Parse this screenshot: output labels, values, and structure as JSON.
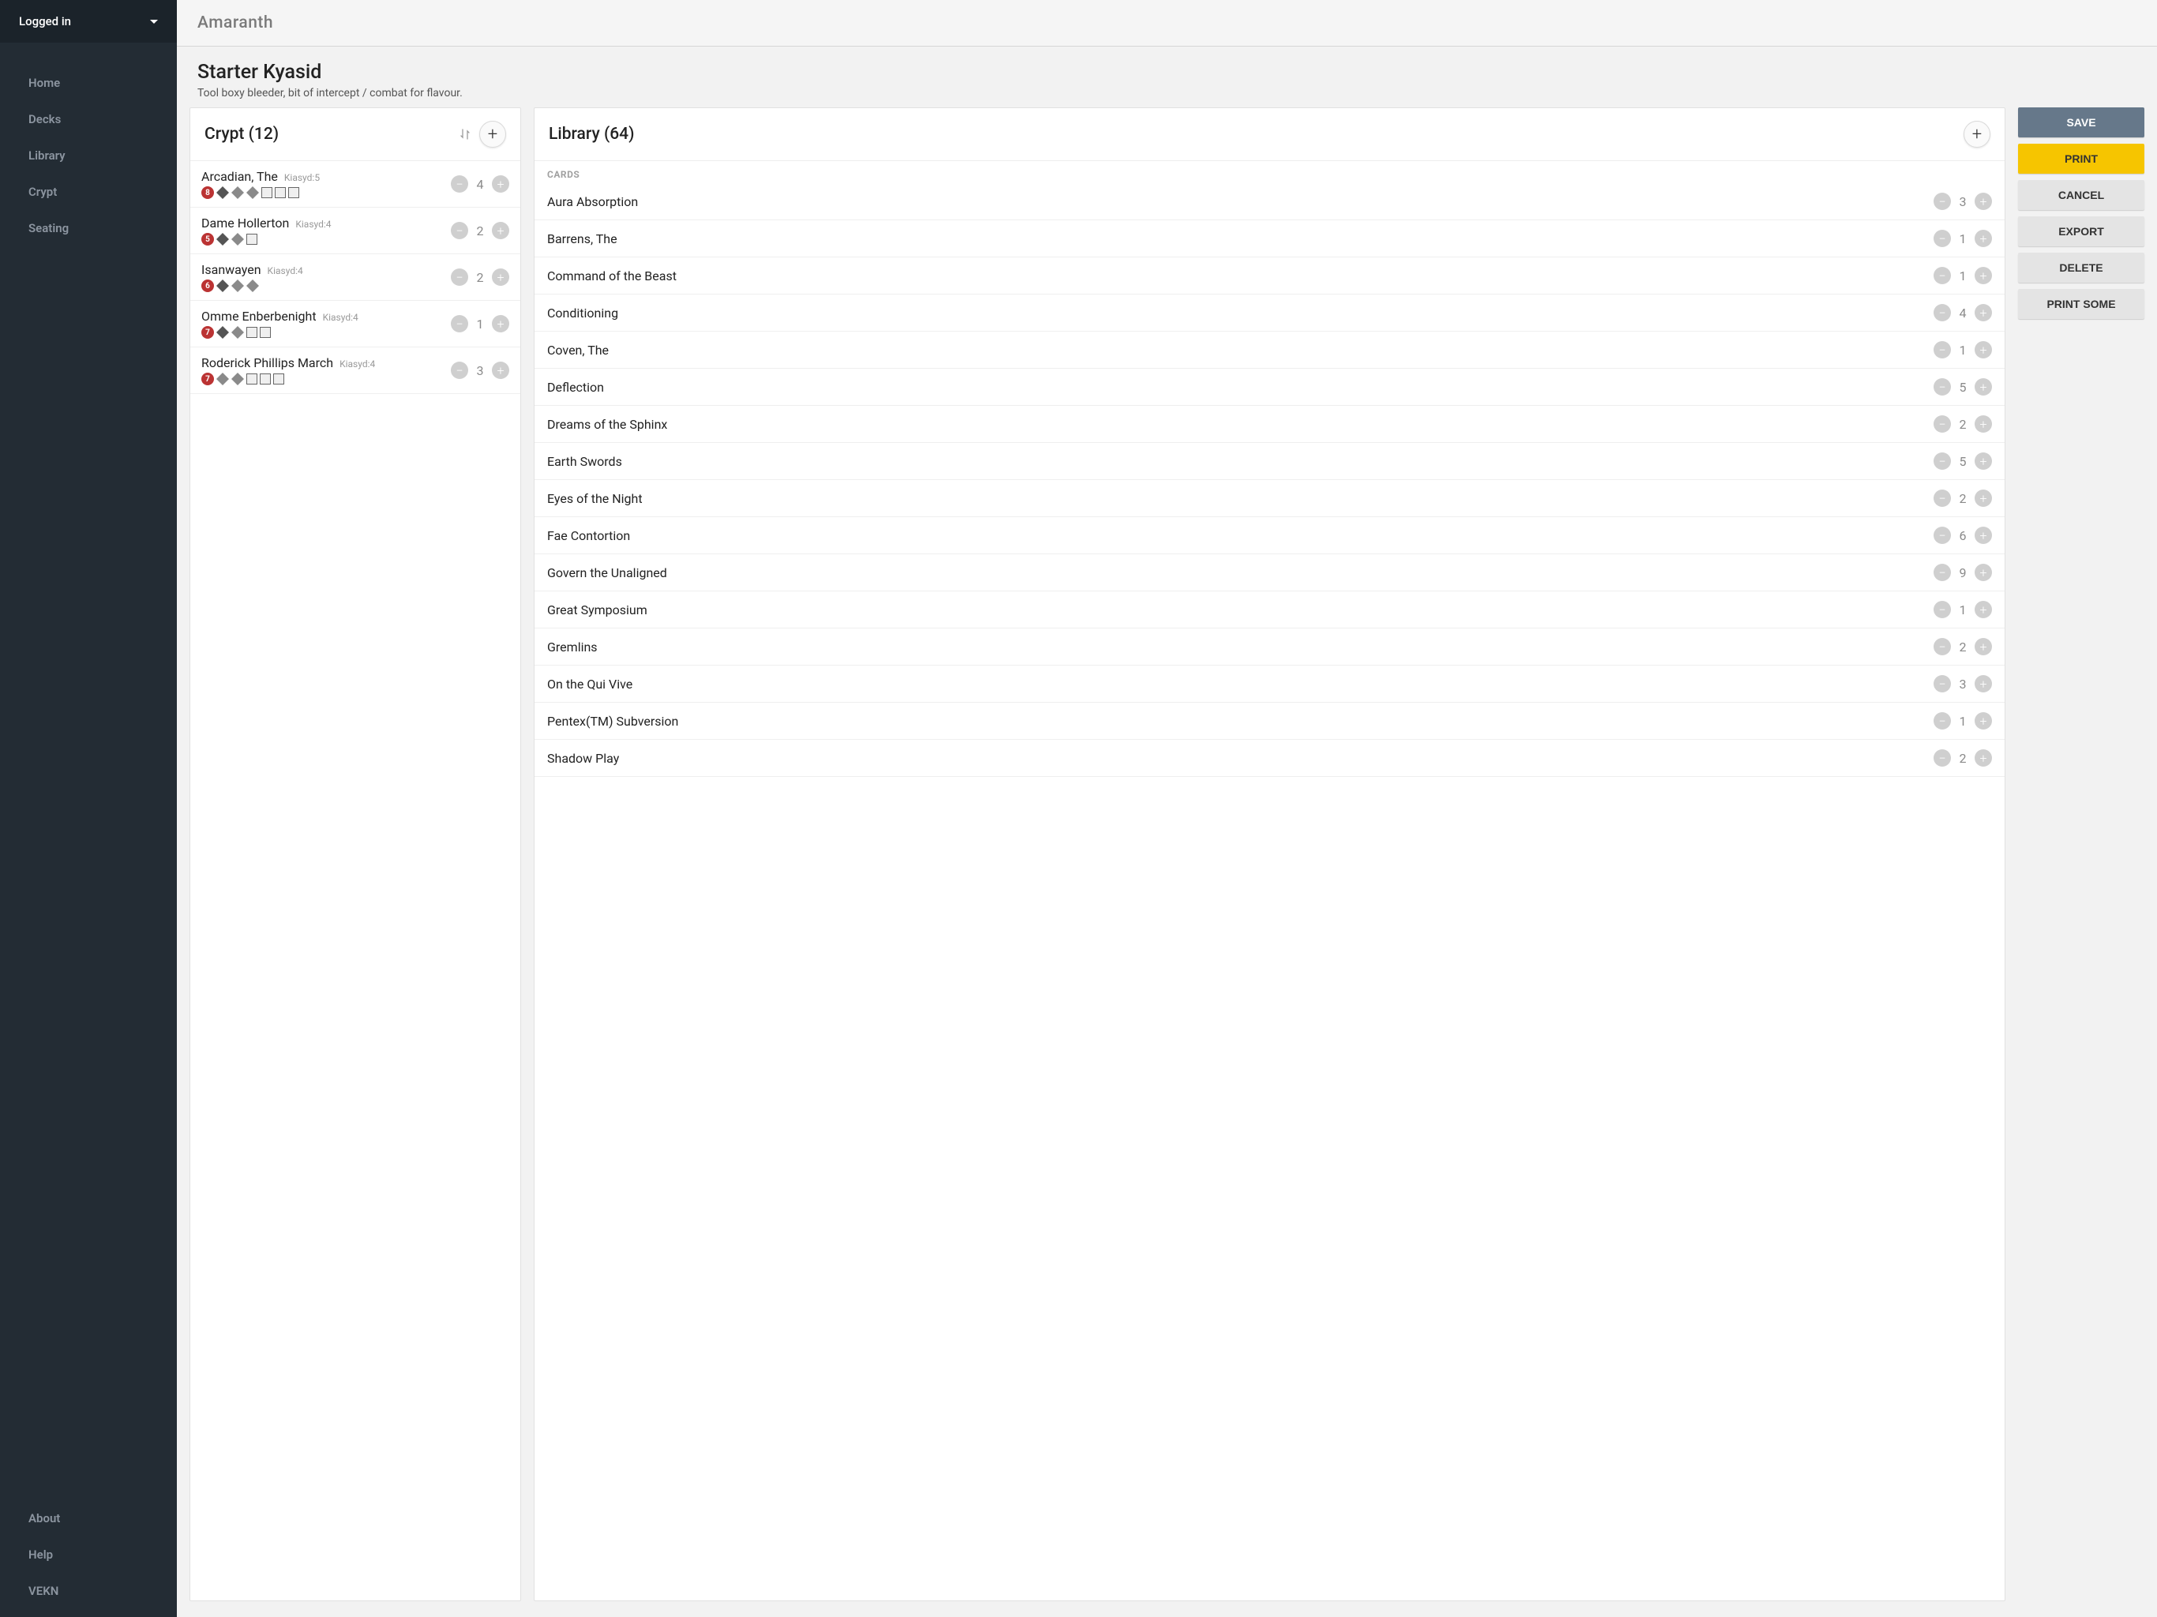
{
  "sidebar": {
    "login_label": "Logged in",
    "nav": [
      "Home",
      "Decks",
      "Library",
      "Crypt",
      "Seating"
    ],
    "nav_bottom": [
      "About",
      "Help",
      "VEKN"
    ]
  },
  "brand": "Amaranth",
  "deck": {
    "title": "Starter Kyasid",
    "description": "Tool boxy bleeder, bit of intercept / combat for flavour."
  },
  "crypt": {
    "title": "Crypt (12)",
    "cards": [
      {
        "name": "Arcadian, The",
        "tag": "Kiasyd:5",
        "cap": 8,
        "count": 4,
        "disc_shapes": [
          "dark",
          "dia",
          "dia",
          "sq",
          "sq",
          "sq"
        ]
      },
      {
        "name": "Dame Hollerton",
        "tag": "Kiasyd:4",
        "cap": 5,
        "count": 2,
        "disc_shapes": [
          "dark",
          "dia",
          "sq"
        ]
      },
      {
        "name": "Isanwayen",
        "tag": "Kiasyd:4",
        "cap": 6,
        "count": 2,
        "disc_shapes": [
          "dark",
          "dia",
          "dia"
        ]
      },
      {
        "name": "Omme Enberbenight",
        "tag": "Kiasyd:4",
        "cap": 7,
        "count": 1,
        "disc_shapes": [
          "dark",
          "dia",
          "sq",
          "sq"
        ]
      },
      {
        "name": "Roderick Phillips March",
        "tag": "Kiasyd:4",
        "cap": 7,
        "count": 3,
        "disc_shapes": [
          "dia",
          "dia",
          "sq",
          "sq",
          "sq"
        ]
      }
    ]
  },
  "library": {
    "title": "Library (64)",
    "section_label": "CARDS",
    "cards": [
      {
        "name": "Aura Absorption",
        "count": 3
      },
      {
        "name": "Barrens, The",
        "count": 1
      },
      {
        "name": "Command of the Beast",
        "count": 1
      },
      {
        "name": "Conditioning",
        "count": 4
      },
      {
        "name": "Coven, The",
        "count": 1
      },
      {
        "name": "Deflection",
        "count": 5
      },
      {
        "name": "Dreams of the Sphinx",
        "count": 2
      },
      {
        "name": "Earth Swords",
        "count": 5
      },
      {
        "name": "Eyes of the Night",
        "count": 2
      },
      {
        "name": "Fae Contortion",
        "count": 6
      },
      {
        "name": "Govern the Unaligned",
        "count": 9
      },
      {
        "name": "Great Symposium",
        "count": 1
      },
      {
        "name": "Gremlins",
        "count": 2
      },
      {
        "name": "On the Qui Vive",
        "count": 3
      },
      {
        "name": "Pentex(TM) Subversion",
        "count": 1
      },
      {
        "name": "Shadow Play",
        "count": 2
      }
    ]
  },
  "actions": {
    "save": "SAVE",
    "print": "PRINT",
    "cancel": "CANCEL",
    "export": "EXPORT",
    "delete": "DELETE",
    "print_some": "PRINT SOME"
  }
}
